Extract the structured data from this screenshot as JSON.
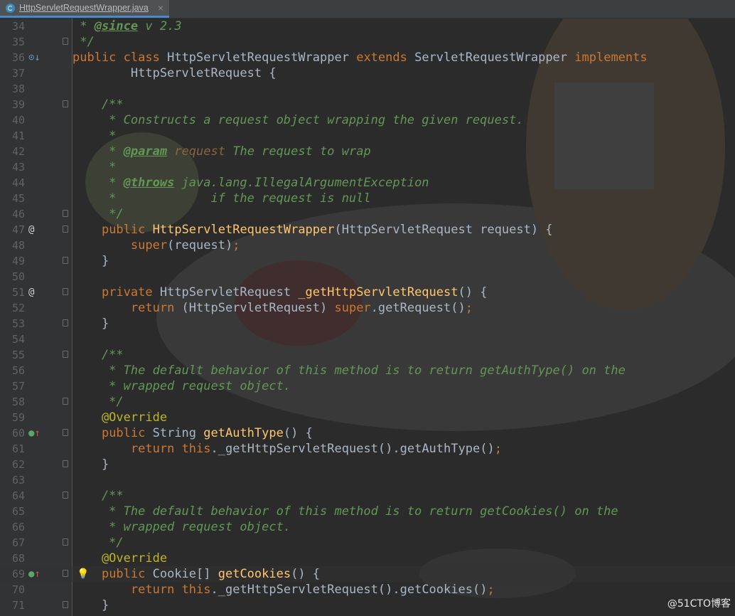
{
  "tab": {
    "file_name": "HttpServletRequestWrapper.java",
    "close": "×"
  },
  "lines": [
    {
      "n": "34",
      "text": " * @since v 2.3"
    },
    {
      "n": "35",
      "text": " */"
    },
    {
      "n": "36",
      "text": "public class HttpServletRequestWrapper extends ServletRequestWrapper implements"
    },
    {
      "n": "37",
      "text": "        HttpServletRequest {"
    },
    {
      "n": "38",
      "text": ""
    },
    {
      "n": "39",
      "text": "    /**"
    },
    {
      "n": "40",
      "text": "     * Constructs a request object wrapping the given request."
    },
    {
      "n": "41",
      "text": "     *"
    },
    {
      "n": "42",
      "text": "     * @param request The request to wrap"
    },
    {
      "n": "43",
      "text": "     *"
    },
    {
      "n": "44",
      "text": "     * @throws java.lang.IllegalArgumentException"
    },
    {
      "n": "45",
      "text": "     *             if the request is null"
    },
    {
      "n": "46",
      "text": "     */"
    },
    {
      "n": "47",
      "text": "    public HttpServletRequestWrapper(HttpServletRequest request) {"
    },
    {
      "n": "48",
      "text": "        super(request);"
    },
    {
      "n": "49",
      "text": "    }"
    },
    {
      "n": "50",
      "text": ""
    },
    {
      "n": "51",
      "text": "    private HttpServletRequest _getHttpServletRequest() {"
    },
    {
      "n": "52",
      "text": "        return (HttpServletRequest) super.getRequest();"
    },
    {
      "n": "53",
      "text": "    }"
    },
    {
      "n": "54",
      "text": ""
    },
    {
      "n": "55",
      "text": "    /**"
    },
    {
      "n": "56",
      "text": "     * The default behavior of this method is to return getAuthType() on the"
    },
    {
      "n": "57",
      "text": "     * wrapped request object."
    },
    {
      "n": "58",
      "text": "     */"
    },
    {
      "n": "59",
      "text": "    @Override"
    },
    {
      "n": "60",
      "text": "    public String getAuthType() {"
    },
    {
      "n": "61",
      "text": "        return this._getHttpServletRequest().getAuthType();"
    },
    {
      "n": "62",
      "text": "    }"
    },
    {
      "n": "63",
      "text": ""
    },
    {
      "n": "64",
      "text": "    /**"
    },
    {
      "n": "65",
      "text": "     * The default behavior of this method is to return getCookies() on the"
    },
    {
      "n": "66",
      "text": "     * wrapped request object."
    },
    {
      "n": "67",
      "text": "     */"
    },
    {
      "n": "68",
      "text": "    @Override"
    },
    {
      "n": "69",
      "text": "    public Cookie[] getCookies() {"
    },
    {
      "n": "70",
      "text": "        return this._getHttpServletRequest().getCookies();"
    },
    {
      "n": "71",
      "text": "    }"
    }
  ],
  "gutter_icons": {
    "36": "implements-icon",
    "47": "override-marker-icon",
    "51": "override-marker-icon",
    "60": "overrides-icon",
    "69": "overrides-icon"
  },
  "gutter_glyphs": {
    "36": "⊙↓",
    "47": "@",
    "51": "@",
    "60": "⊙↑",
    "69": "⊙↑"
  },
  "bulb_line": "69",
  "bulb_glyph": "💡",
  "watermark": "@51CTO博客",
  "colors": {
    "keyword": "#cc7832",
    "comment": "#629755",
    "annotation": "#bbb529",
    "method": "#ffc66d",
    "text": "#a9b7c6",
    "background": "#2b2b2b",
    "gutter": "#313335"
  }
}
